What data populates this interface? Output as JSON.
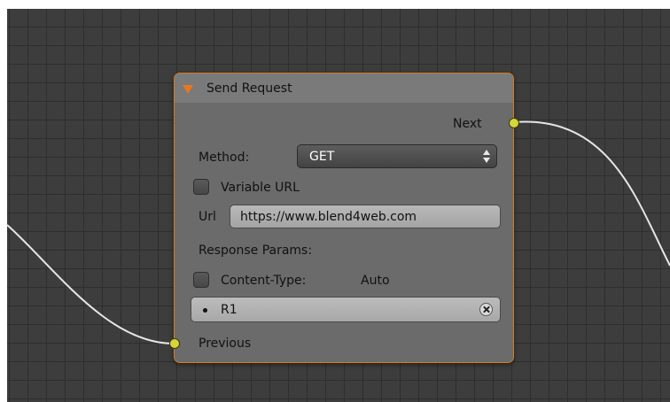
{
  "node": {
    "title": "Send Request",
    "output_socket_label": "Next",
    "method": {
      "label": "Method:",
      "value": "GET"
    },
    "variable_url": {
      "label": "Variable URL",
      "checked": false
    },
    "url": {
      "label": "Url",
      "value": "https://www.blend4web.com"
    },
    "response_params_label": "Response Params:",
    "content_type": {
      "label": "Content-Type:",
      "value": "Auto",
      "checked": false
    },
    "params_list": [
      {
        "label": "R1"
      }
    ],
    "input_socket_label": "Previous"
  },
  "colors": {
    "frame_border": "#d77a1a",
    "collapse_arrow": "#e8771d",
    "socket": "#d6d63a",
    "wire": "#e6e6e6",
    "grid_background": "#3d3d3d"
  },
  "icons": {
    "collapse": "triangle-down-icon",
    "remove_item": "close-circle-icon",
    "select_arrows": "up-down-arrows-icon"
  }
}
